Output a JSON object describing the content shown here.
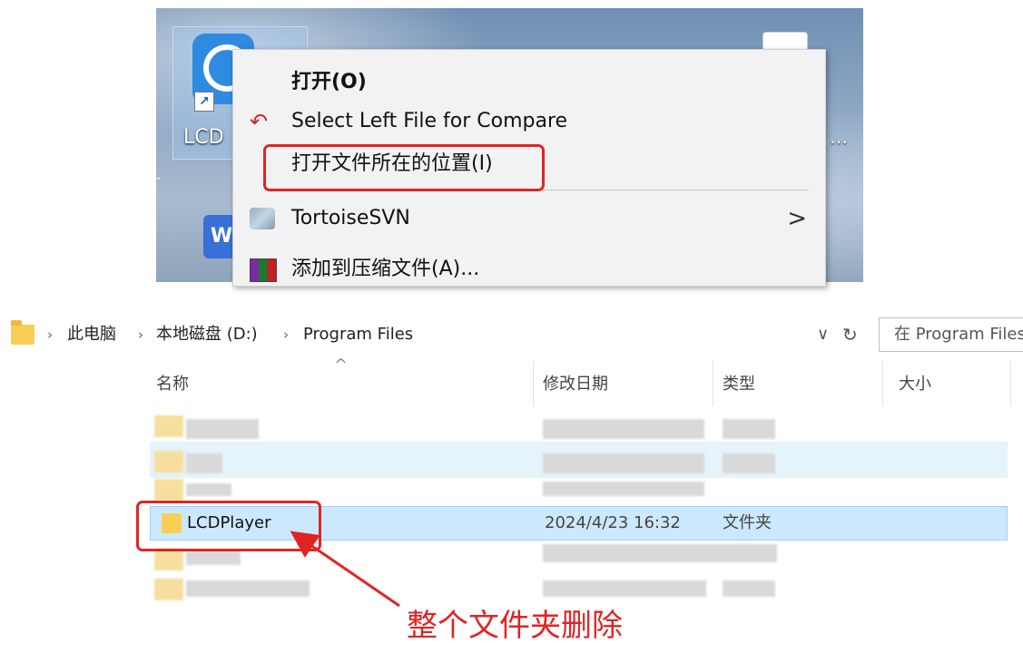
{
  "context_menu": {
    "items": [
      {
        "label": "打开(O)"
      },
      {
        "label": "Select Left File for Compare"
      },
      {
        "label": "打开文件所在的位置(I)"
      },
      {
        "label": "TortoiseSVN",
        "has_submenu": true,
        "chevron": ">"
      },
      {
        "label": "添加到压缩文件(A)..."
      }
    ]
  },
  "desktop": {
    "icon_label": "LCD"
  },
  "explorer": {
    "breadcrumb": [
      "此电脑",
      "本地磁盘 (D:)",
      "Program Files"
    ],
    "search_placeholder": "在 Program Files",
    "columns": {
      "name": "名称",
      "date": "修改日期",
      "type": "类型",
      "size": "大小"
    },
    "selected_row": {
      "name": "LCDPlayer",
      "date": "2024/4/23 16:32",
      "type": "文件夹"
    }
  },
  "annotation": {
    "text": "整个文件夹删除",
    "color": "#e02424"
  },
  "colors": {
    "highlight_red": "#e02424",
    "selection_blue": "#cce8ff",
    "folder_yellow": "#f7cf55"
  }
}
